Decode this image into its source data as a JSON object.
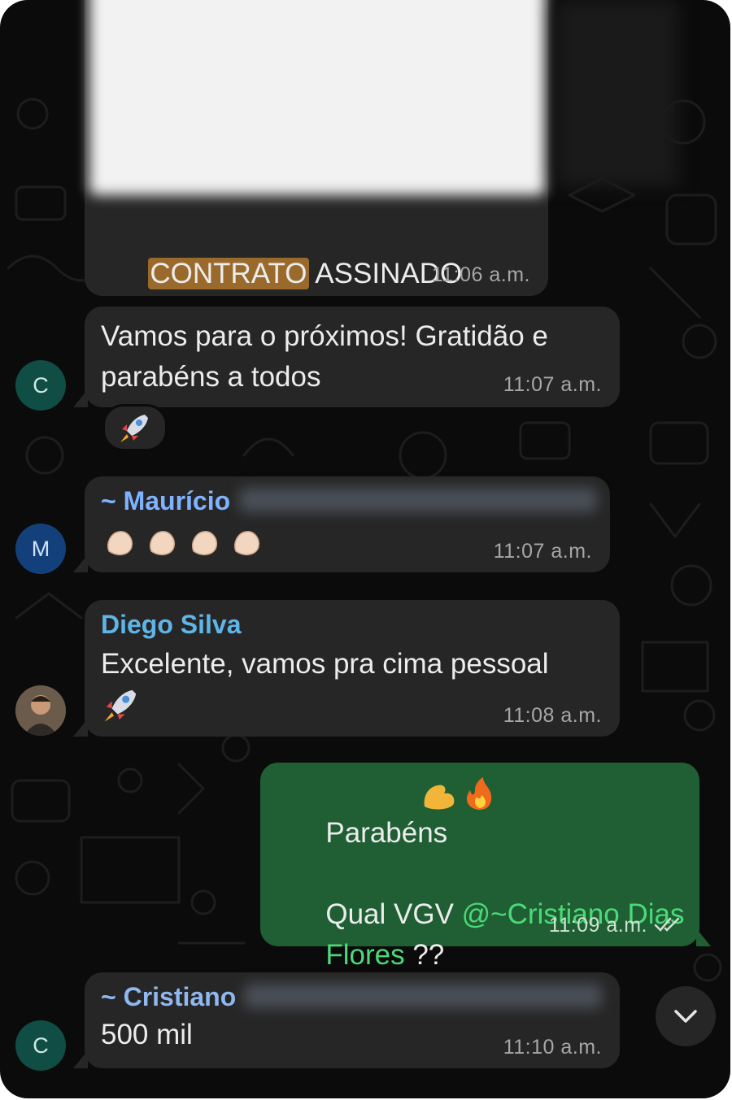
{
  "colors": {
    "background": "#0b0b0b",
    "incoming_bubble": "#262626",
    "outgoing_bubble": "#1f5f33",
    "highlight": "#9a6a2c",
    "sender_mauricio": "#7fb3ff",
    "sender_diego": "#5fb5e8",
    "sender_cristiano": "#8fb8f0",
    "mention": "#4cd97a",
    "avatar_c": "#0f4d45",
    "avatar_m": "#13407a"
  },
  "messages": [
    {
      "id": "contract",
      "highlight_text": "CONTRATO",
      "text_rest": " ASSINADO",
      "time": "11:06 a.m."
    },
    {
      "id": "c1",
      "text": "Vamos para o próximos! Gratidão e\nparabéns a todos",
      "time": "11:07 a.m.",
      "avatar": "C",
      "reaction_icon": "rocket-emoji"
    },
    {
      "id": "mauricio",
      "sender": "~ Maurício",
      "icon": "clapping-hands-emoji",
      "time": "11:07 a.m.",
      "avatar": "M"
    },
    {
      "id": "diego",
      "sender": "Diego Silva",
      "text": "Excelente, vamos pra cima pessoal",
      "icon": "rocket-emoji",
      "time": "11:08 a.m.",
      "avatar_icon": "profile-photo"
    },
    {
      "id": "outgoing",
      "text_line1": "Parabéns",
      "icon": "flexed-biceps-and-fire-emoji",
      "text_line2": "Qual VGV ",
      "mention_line1": "@~Cristiano Dias",
      "mention_line2": "Flores",
      "text_after_mention": " ??",
      "time": "11:09 a.m.",
      "status_icon": "double-check-icon"
    },
    {
      "id": "cristiano",
      "sender": "~ Cristiano",
      "text": "500 mil",
      "time": "11:10 a.m.",
      "avatar": "C"
    }
  ],
  "controls": {
    "scroll_down_icon": "chevron-down-icon"
  }
}
